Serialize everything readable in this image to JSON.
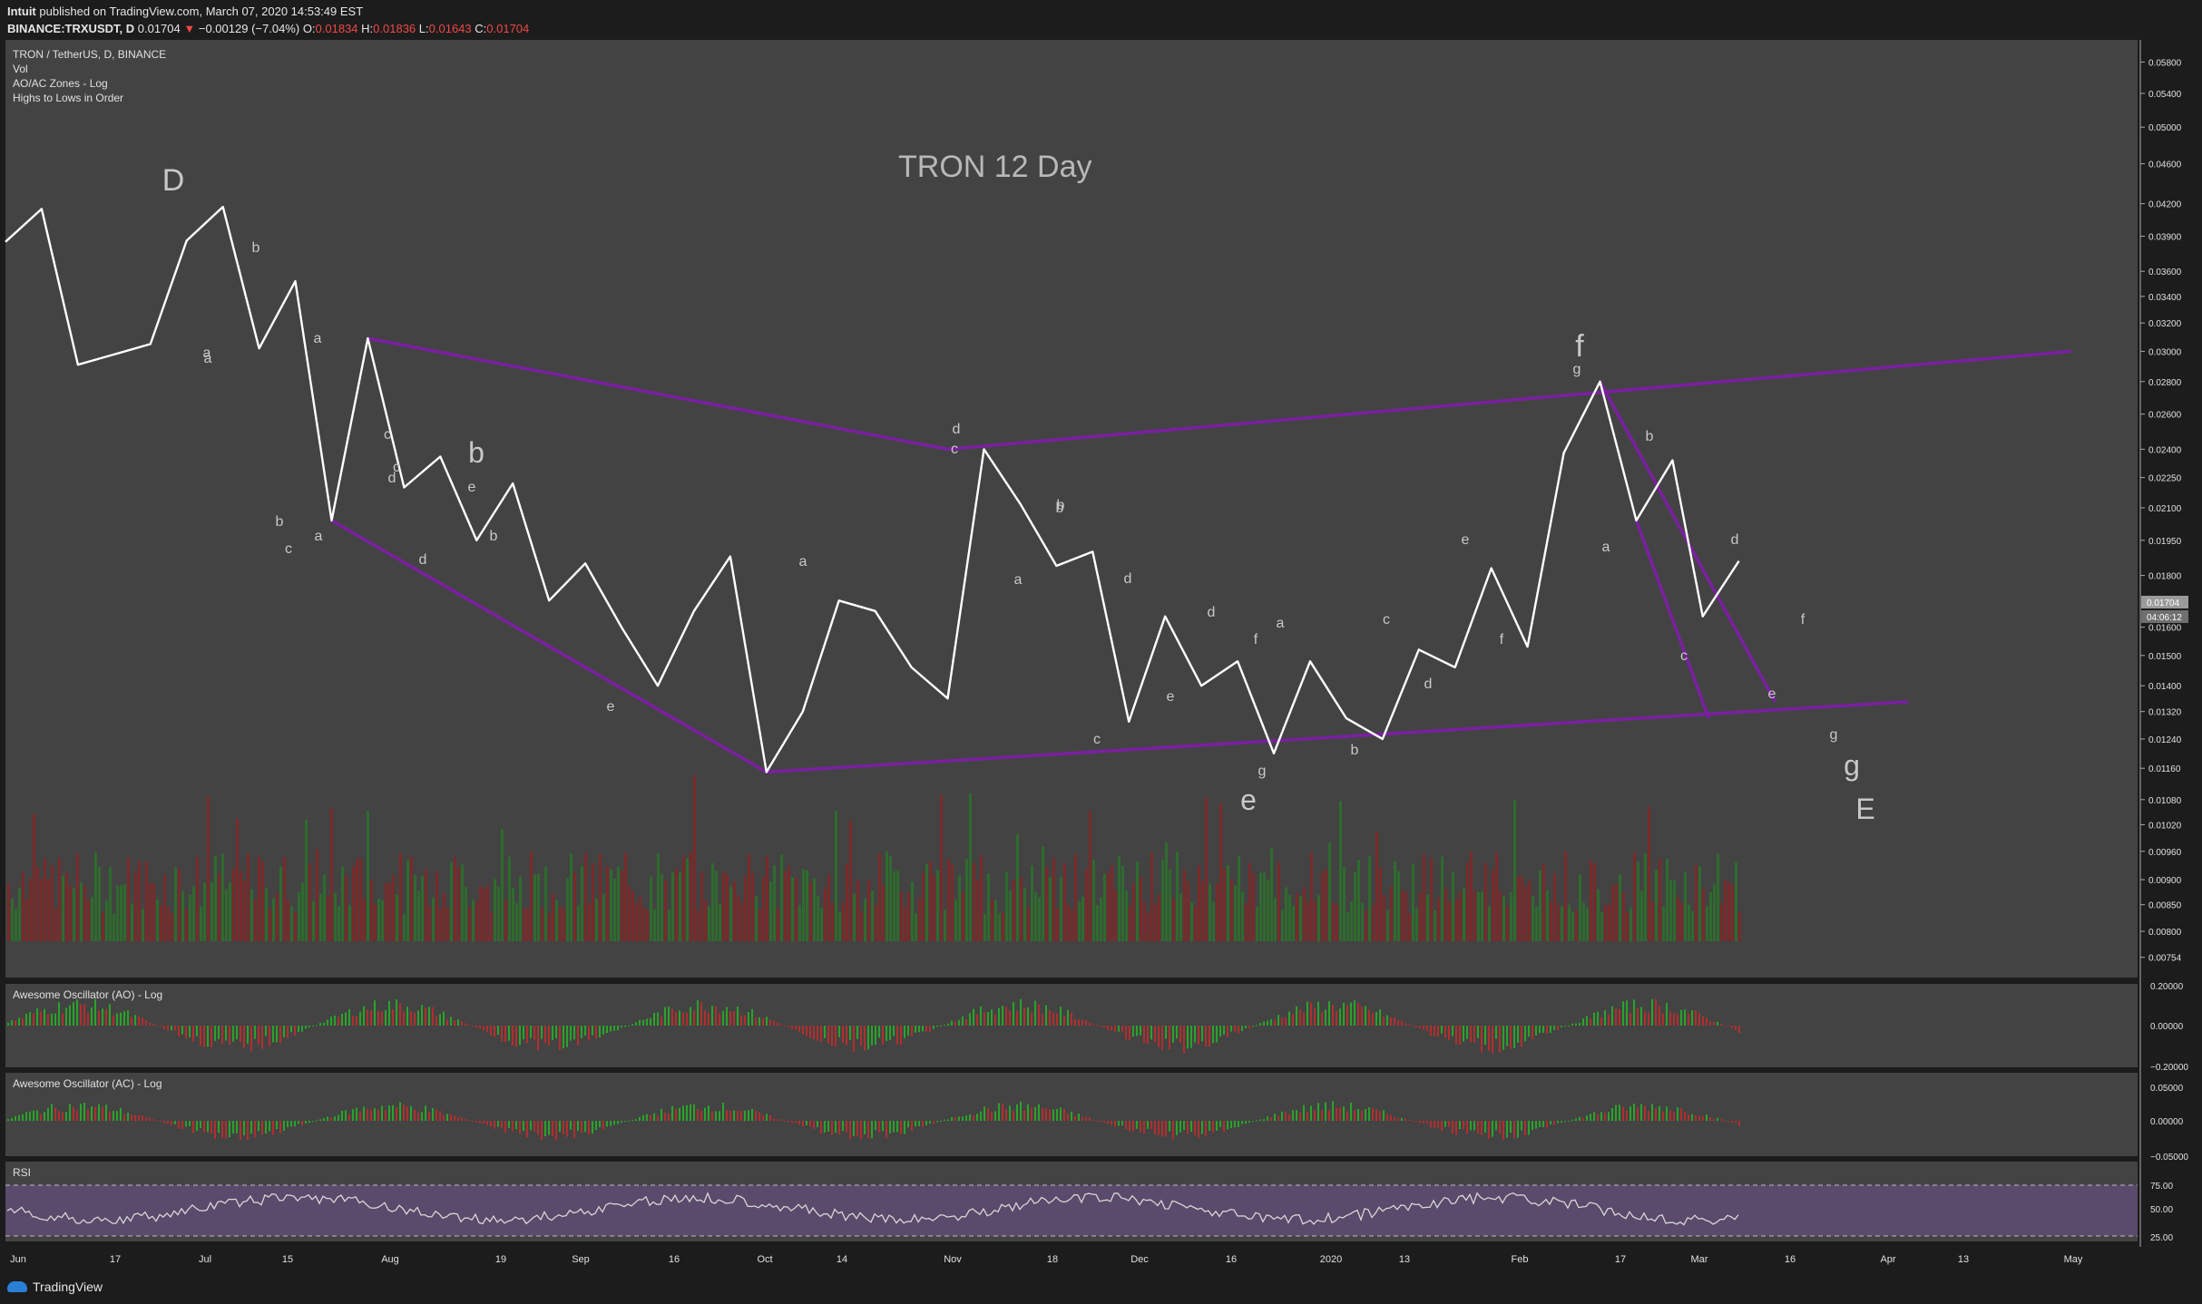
{
  "header": {
    "author": "Intuit",
    "published": "published on TradingView.com, March 07, 2020 14:53:49 EST",
    "symbol": "BINANCE:TRXUSDT, D",
    "last": "0.01704",
    "change": "−0.00129 (−7.04%)",
    "open_label": "O:",
    "open": "0.01834",
    "high_label": "H:",
    "high": "0.01836",
    "low_label": "L:",
    "low": "0.01643",
    "close_label": "C:",
    "close": "0.01704"
  },
  "legend": [
    "TRON / TetherUS, D, BINANCE",
    "Vol",
    "AO/AC Zones - Log",
    "Highs to Lows in Order"
  ],
  "title": "TRON 12 Day",
  "price_axis_labels": [
    "0.05800",
    "0.05400",
    "0.05000",
    "0.04600",
    "0.04200",
    "0.03900",
    "0.03600",
    "0.03400",
    "0.03200",
    "0.03000",
    "0.02800",
    "0.02600",
    "0.02400",
    "0.02250",
    "0.02100",
    "0.01950",
    "0.01800",
    "0.01600",
    "0.01500",
    "0.01400",
    "0.01320",
    "0.01240",
    "0.01160",
    "0.01080",
    "0.01020",
    "0.00960",
    "0.00900",
    "0.00850",
    "0.00800",
    "0.00754"
  ],
  "price_tag": "0.01704",
  "countdown": "04:06:12",
  "time_axis_labels": [
    "Jun",
    "17",
    "Jul",
    "15",
    "Aug",
    "19",
    "Sep",
    "16",
    "Oct",
    "14",
    "Nov",
    "18",
    "Dec",
    "16",
    "2020",
    "13",
    "Feb",
    "17",
    "Mar",
    "16",
    "Apr",
    "13",
    "May"
  ],
  "panes": {
    "ao": {
      "title": "Awesome Oscillator (AO) - Log",
      "ticks": [
        "0.20000",
        "0.00000",
        "−0.20000"
      ]
    },
    "ac": {
      "title": "Awesome Oscillator (AC) - Log",
      "ticks": [
        "0.05000",
        "0.00000",
        "−0.05000"
      ]
    },
    "rsi": {
      "title": "RSI",
      "ticks": [
        "75.00",
        "50.00",
        "25.00"
      ]
    }
  },
  "wave_labels": [
    "D",
    "b",
    "a",
    "a",
    "c",
    "a",
    "b",
    "b",
    "e",
    "d",
    "b",
    "a",
    "c",
    "d",
    "c",
    "e",
    "a",
    "b",
    "d",
    "c",
    "a",
    "b",
    "d",
    "c",
    "e",
    "d",
    "f",
    "g",
    "e",
    "a",
    "b",
    "c",
    "d",
    "e",
    "f",
    "f",
    "g",
    "a",
    "b",
    "c",
    "d",
    "e",
    "f",
    "g",
    "g",
    "E"
  ],
  "branding": "TradingView",
  "colors": {
    "background": "#434343",
    "price_line": "#ffffff",
    "trendline": "#7b1fa2",
    "volume_up": "#2e6b2e",
    "volume_down": "#7a2a2a",
    "ao_up": "#28a428",
    "ao_down": "#b22e2e",
    "rsi_band": "#5a4a6b",
    "rsi_line": "#d7d7d7"
  },
  "chart_data": {
    "type": "line",
    "title": "TRON 12 Day",
    "series": [
      {
        "name": "TRON / TetherUS, D, BINANCE",
        "x": [
          "2019-05-25",
          "2019-05-31",
          "2019-06-06",
          "2019-06-18",
          "2019-06-24",
          "2019-06-30",
          "2019-07-06",
          "2019-07-12",
          "2019-07-18",
          "2019-07-24",
          "2019-07-30",
          "2019-08-05",
          "2019-08-11",
          "2019-08-17",
          "2019-08-23",
          "2019-08-29",
          "2019-09-04",
          "2019-09-10",
          "2019-09-16",
          "2019-09-22",
          "2019-09-28",
          "2019-10-04",
          "2019-10-10",
          "2019-10-16",
          "2019-10-22",
          "2019-10-28",
          "2019-11-03",
          "2019-11-09",
          "2019-11-15",
          "2019-11-21",
          "2019-11-27",
          "2019-12-03",
          "2019-12-09",
          "2019-12-15",
          "2019-12-21",
          "2019-12-27",
          "2020-01-02",
          "2020-01-08",
          "2020-01-14",
          "2020-01-20",
          "2020-01-26",
          "2020-02-01",
          "2020-02-07",
          "2020-02-13",
          "2020-02-19",
          "2020-02-25",
          "2020-03-01",
          "2020-03-07"
        ],
        "y": [
          0.0385,
          0.0415,
          0.0291,
          0.0305,
          0.0386,
          0.0417,
          0.0302,
          0.0352,
          0.0204,
          0.0309,
          0.022,
          0.0236,
          0.0195,
          0.0222,
          0.017,
          0.0185,
          0.016,
          0.014,
          0.0166,
          0.0188,
          0.0115,
          0.0132,
          0.017,
          0.0166,
          0.0146,
          0.0136,
          0.024,
          0.0212,
          0.0184,
          0.019,
          0.0129,
          0.0164,
          0.014,
          0.0148,
          0.012,
          0.0148,
          0.013,
          0.0124,
          0.0152,
          0.0146,
          0.0183,
          0.0153,
          0.0238,
          0.028,
          0.0204,
          0.0234,
          0.0164,
          0.0186
        ]
      }
    ],
    "trendlines": [
      {
        "from": [
          "2019-07-18",
          0.0204
        ],
        "to": [
          "2019-09-28",
          0.0115
        ]
      },
      {
        "from": [
          "2019-07-24",
          0.0309
        ],
        "to": [
          "2019-10-28",
          0.024
        ]
      },
      {
        "from": [
          "2019-10-28",
          0.024
        ],
        "to": [
          "2020-05-01",
          0.03
        ]
      },
      {
        "from": [
          "2019-09-28",
          0.0115
        ],
        "to": [
          "2020-04-04",
          0.0135
        ]
      },
      {
        "from": [
          "2020-02-13",
          0.028
        ],
        "to": [
          "2020-03-13",
          0.0135
        ]
      },
      {
        "from": [
          "2020-02-19",
          0.0204
        ],
        "to": [
          "2020-03-02",
          0.013
        ]
      }
    ],
    "yscale": "log",
    "ylim": [
      0.0072,
      0.061
    ],
    "xlim": [
      "2019-05-25",
      "2020-05-12"
    ],
    "grid": false,
    "legend": "top-left"
  }
}
